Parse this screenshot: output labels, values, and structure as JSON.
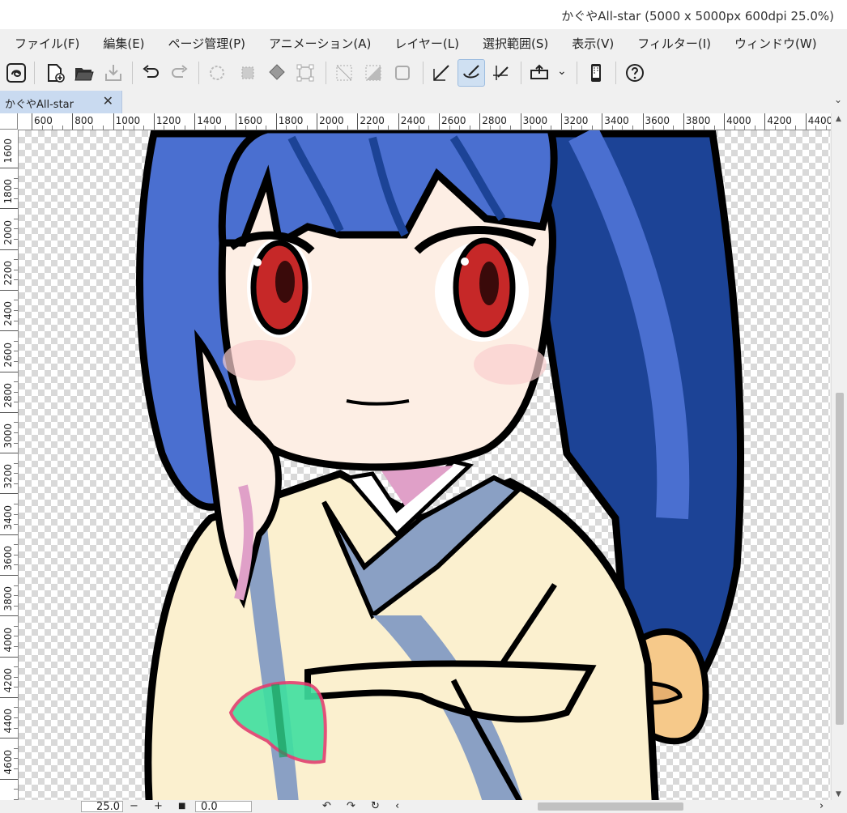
{
  "window": {
    "title": "かぐやAll-star (5000 x 5000px 600dpi 25.0%)",
    "minimize": "-"
  },
  "menu": {
    "items": [
      "ファイル(F)",
      "編集(E)",
      "ページ管理(P)",
      "アニメーション(A)",
      "レイヤー(L)",
      "選択範囲(S)",
      "表示(V)",
      "フィルター(I)",
      "ウィンドウ(W)"
    ],
    "more": "›"
  },
  "toolbar": {
    "icons": [
      "clip-studio-icon",
      "new-file-icon",
      "open-file-icon",
      "save-icon",
      "undo-icon",
      "redo-icon",
      "clear-icon",
      "clear-outside-icon",
      "fill-icon",
      "transform-icon",
      "deselect-icon",
      "invert-selection-icon",
      "show-selection-icon",
      "snap-ruler-icon",
      "snap-special-ruler-icon",
      "snap-grid-icon",
      "export-icon",
      "smartphone-icon",
      "help-icon"
    ],
    "active": "snap-special-ruler-icon",
    "dropdown": "⌄"
  },
  "tabs": [
    {
      "label": "かぐやAll-star",
      "close": "✕"
    }
  ],
  "tab_overflow": "⌄",
  "ruler": {
    "h_labels": [
      "600",
      "800",
      "1000",
      "1200",
      "1400",
      "1600",
      "1800",
      "2000",
      "2200",
      "2400",
      "2600",
      "2800",
      "3000",
      "3200",
      "3400",
      "3600",
      "3800",
      "4000",
      "4200",
      "4400"
    ],
    "v_labels": [
      "1600",
      "1800",
      "2000",
      "2200",
      "2400",
      "2600",
      "2800",
      "3000",
      "3200",
      "3400",
      "3600",
      "3800",
      "4000",
      "4200",
      "4400",
      "4600"
    ]
  },
  "canvas": {
    "colors": {
      "hair": "#4a6fd0",
      "hair_dark": "#1c4396",
      "skin": "#fdeee4",
      "kimono": "#fbf0cf",
      "kimono_blue": "#8aa0c4",
      "eye": "#c62828",
      "outline": "#000000",
      "bow": "#f6c98a",
      "accent_green": "#3fe0a0",
      "accent_pink": "#e04070"
    }
  },
  "statusbar": {
    "zoom_value": "25.0",
    "zoom_out": "−",
    "zoom_in": "+",
    "stop": "■",
    "rotation_value": "0.0",
    "rotate_left": "↶",
    "rotate_right": "↷",
    "rotate_reset": "↻",
    "scroll_left": "‹",
    "scroll_right": "›"
  }
}
